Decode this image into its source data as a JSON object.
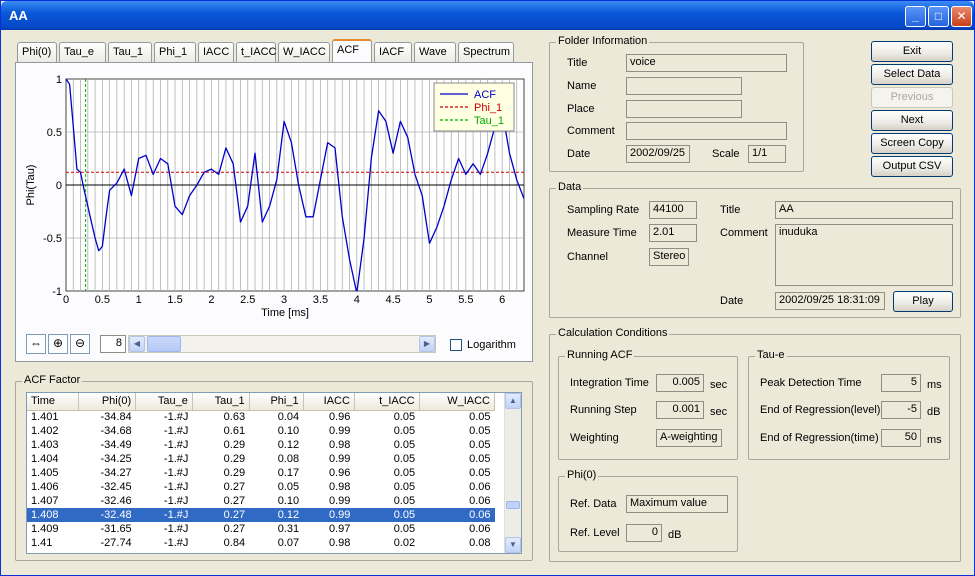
{
  "window": {
    "title": "AA"
  },
  "tabs": [
    "Phi(0)",
    "Tau_e",
    "Tau_1",
    "Phi_1",
    "IACC",
    "t_IACC",
    "W_IACC",
    "ACF",
    "IACF",
    "Wave",
    "Spectrum"
  ],
  "active_tab": "ACF",
  "chart_data": {
    "type": "line",
    "xlabel": "Time [ms]",
    "ylabel": "Phi(Tau)",
    "xlim": [
      0,
      6.3
    ],
    "ylim": [
      -1,
      1
    ],
    "xticks": [
      "0",
      "0.5",
      "1",
      "1.5",
      "2",
      "2.5",
      "3",
      "3.5",
      "4",
      "4.5",
      "5",
      "5.5",
      "6"
    ],
    "yticks": [
      "1",
      "0.5",
      "0",
      "-0.5",
      "-1"
    ],
    "grid": true,
    "legend_position": "top-right",
    "series": [
      {
        "name": "ACF",
        "color": "#0000cc",
        "x": [
          0,
          0.05,
          0.1,
          0.15,
          0.2,
          0.25,
          0.3,
          0.35,
          0.4,
          0.45,
          0.5,
          0.55,
          0.6,
          0.7,
          0.8,
          0.9,
          1.0,
          1.1,
          1.2,
          1.3,
          1.4,
          1.5,
          1.6,
          1.7,
          1.8,
          1.9,
          2.0,
          2.1,
          2.2,
          2.3,
          2.4,
          2.5,
          2.6,
          2.7,
          2.8,
          2.9,
          3.0,
          3.1,
          3.2,
          3.3,
          3.4,
          3.5,
          3.6,
          3.7,
          3.8,
          3.9,
          4.0,
          4.1,
          4.2,
          4.3,
          4.4,
          4.5,
          4.6,
          4.7,
          4.8,
          4.9,
          5.0,
          5.1,
          5.2,
          5.3,
          5.4,
          5.5,
          5.6,
          5.7,
          5.8,
          5.9,
          6.0,
          6.1,
          6.2,
          6.3
        ],
        "y": [
          1,
          0.95,
          0.55,
          0.15,
          0.12,
          -0.05,
          -0.2,
          -0.35,
          -0.5,
          -0.62,
          -0.58,
          -0.3,
          -0.05,
          0.02,
          0.15,
          -0.1,
          0.25,
          0.28,
          0.1,
          0.25,
          0.2,
          -0.2,
          -0.28,
          -0.1,
          0.0,
          0.12,
          0.15,
          0.1,
          0.35,
          0.2,
          -0.35,
          -0.2,
          0.3,
          -0.35,
          -0.2,
          0.05,
          0.6,
          0.4,
          0.0,
          -0.3,
          -0.3,
          0.05,
          0.4,
          0.35,
          -0.3,
          -0.7,
          -1.02,
          -0.5,
          0.25,
          0.7,
          0.6,
          0.3,
          0.6,
          0.45,
          0.1,
          -0.1,
          -0.55,
          -0.4,
          -0.2,
          0.05,
          0.25,
          0.1,
          0.2,
          0.1,
          0.3,
          0.55,
          0.7,
          0.3,
          0.05,
          -0.13
        ]
      },
      {
        "name": "Phi_1",
        "color": "#cc0000",
        "style": "dashed",
        "y_const": 0.12
      },
      {
        "name": "Tau_1",
        "color": "#00aa00",
        "style": "dashed",
        "x_const": 0.27
      }
    ]
  },
  "chart_tools": {
    "page": "8",
    "logarithm_label": "Logarithm",
    "logarithm_checked": false,
    "fit_icon": "fit-width-icon",
    "zoom_in_icon": "zoom-in-icon",
    "zoom_out_icon": "zoom-out-icon"
  },
  "acf_factor": {
    "legend": "ACF Factor",
    "columns": [
      "Time",
      "Phi(0)",
      "Tau_e",
      "Tau_1",
      "Phi_1",
      "IACC",
      "t_IACC",
      "W_IACC"
    ],
    "rows": [
      [
        "1.401",
        "-34.84",
        "-1.#J",
        "0.63",
        "0.04",
        "0.96",
        "0.05",
        "0.05"
      ],
      [
        "1.402",
        "-34.68",
        "-1.#J",
        "0.61",
        "0.10",
        "0.99",
        "0.05",
        "0.05"
      ],
      [
        "1.403",
        "-34.49",
        "-1.#J",
        "0.29",
        "0.12",
        "0.98",
        "0.05",
        "0.05"
      ],
      [
        "1.404",
        "-34.25",
        "-1.#J",
        "0.29",
        "0.08",
        "0.99",
        "0.05",
        "0.05"
      ],
      [
        "1.405",
        "-34.27",
        "-1.#J",
        "0.29",
        "0.17",
        "0.96",
        "0.05",
        "0.05"
      ],
      [
        "1.406",
        "-32.45",
        "-1.#J",
        "0.27",
        "0.05",
        "0.98",
        "0.05",
        "0.06"
      ],
      [
        "1.407",
        "-32.46",
        "-1.#J",
        "0.27",
        "0.10",
        "0.99",
        "0.05",
        "0.06"
      ],
      [
        "1.408",
        "-32.48",
        "-1.#J",
        "0.27",
        "0.12",
        "0.99",
        "0.05",
        "0.06"
      ],
      [
        "1.409",
        "-31.65",
        "-1.#J",
        "0.27",
        "0.31",
        "0.97",
        "0.05",
        "0.06"
      ],
      [
        "1.41",
        "-27.74",
        "-1.#J",
        "0.84",
        "0.07",
        "0.98",
        "0.02",
        "0.08"
      ]
    ],
    "selected_row": 7
  },
  "folder_info": {
    "legend": "Folder Information",
    "title_label": "Title",
    "title_value": "voice",
    "name_label": "Name",
    "name_value": "",
    "place_label": "Place",
    "place_value": "",
    "comment_label": "Comment",
    "comment_value": "",
    "date_label": "Date",
    "date_value": "2002/09/25",
    "scale_label": "Scale",
    "scale_value": "1/1"
  },
  "buttons": {
    "exit": "Exit",
    "select_data": "Select Data",
    "previous": "Previous",
    "next": "Next",
    "screen_copy": "Screen Copy",
    "output_csv": "Output CSV"
  },
  "data_group": {
    "legend": "Data",
    "sampling_rate_label": "Sampling Rate",
    "sampling_rate_value": "44100",
    "measure_time_label": "Measure Time",
    "measure_time_value": "2.01",
    "channel_label": "Channel",
    "channel_value": "Stereo",
    "title_label": "Title",
    "title_value": "AA",
    "comment_label": "Comment",
    "comment_value": "inuduka",
    "date_label": "Date",
    "date_value": "2002/09/25 18:31:09",
    "play_button": "Play"
  },
  "calc": {
    "legend": "Calculation Conditions",
    "running_acf": {
      "legend": "Running ACF",
      "integration_label": "Integration Time",
      "integration_value": "0.005",
      "integration_unit": "sec",
      "step_label": "Running Step",
      "step_value": "0.001",
      "step_unit": "sec",
      "weighting_label": "Weighting",
      "weighting_value": "A-weighting"
    },
    "tau_e": {
      "legend": "Tau-e",
      "peak_label": "Peak Detection Time",
      "peak_value": "5",
      "peak_unit": "ms",
      "level_label": "End of Regression(level)",
      "level_value": "-5",
      "level_unit": "dB",
      "time_label": "End of Regression(time)",
      "time_value": "50",
      "time_unit": "ms"
    },
    "phi0": {
      "legend": "Phi(0)",
      "ref_data_label": "Ref. Data",
      "ref_data_value": "Maximum value",
      "ref_level_label": "Ref. Level",
      "ref_level_value": "0",
      "ref_level_unit": "dB"
    }
  }
}
